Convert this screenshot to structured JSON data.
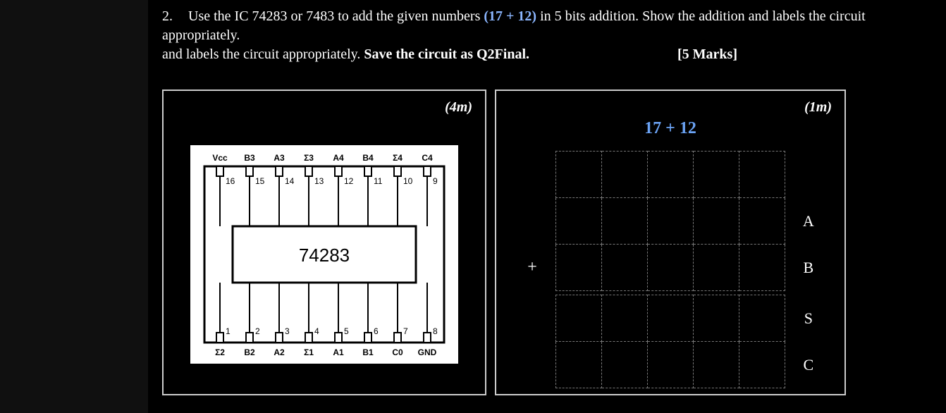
{
  "question": {
    "number": "2.",
    "text_a": "Use the IC 74283 or 7483 to add the given numbers ",
    "accent": "(17 + 12)",
    "text_b": " in 5 bits addition.  Show the addition and labels the circuit appropriately. ",
    "bold_tail": "Save the circuit as Q2Final.",
    "marks": "[5 Marks]"
  },
  "panel_left": {
    "marks": "(4m)",
    "chip": {
      "name": "74283",
      "top_pins": [
        {
          "label": "Vcc",
          "num": "16"
        },
        {
          "label": "B3",
          "num": "15"
        },
        {
          "label": "A3",
          "num": "14"
        },
        {
          "label": "Σ3",
          "num": "13"
        },
        {
          "label": "A4",
          "num": "12"
        },
        {
          "label": "B4",
          "num": "11"
        },
        {
          "label": "Σ4",
          "num": "10"
        },
        {
          "label": "C4",
          "num": "9"
        }
      ],
      "bottom_pins": [
        {
          "label": "Σ2",
          "num": "1"
        },
        {
          "label": "B2",
          "num": "2"
        },
        {
          "label": "A2",
          "num": "3"
        },
        {
          "label": "Σ1",
          "num": "4"
        },
        {
          "label": "A1",
          "num": "5"
        },
        {
          "label": "B1",
          "num": "6"
        },
        {
          "label": "C0",
          "num": "7"
        },
        {
          "label": "GND",
          "num": "8"
        }
      ]
    }
  },
  "panel_right": {
    "marks": "(1m)",
    "title": "17 + 12",
    "plus": "+",
    "row_labels": [
      "A",
      "B",
      "S",
      "C"
    ]
  }
}
